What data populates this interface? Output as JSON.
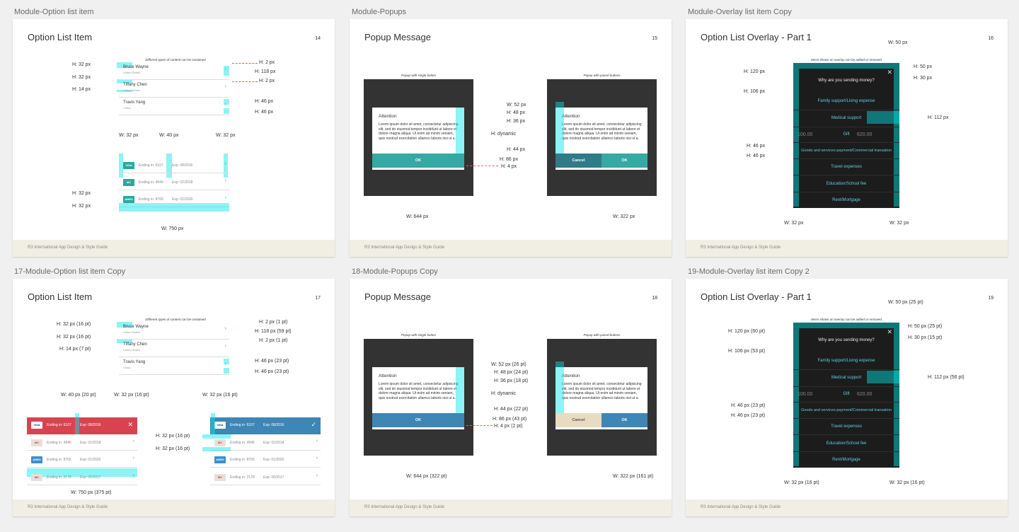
{
  "frames": [
    {
      "label": "Module-Option list item",
      "title": "Option List Item",
      "page": "14",
      "caption": "Different types of content can be contained",
      "people": [
        {
          "name": "Bruce Wayne",
          "sub": "United States"
        },
        {
          "name": "Tiffany Chen",
          "sub": "United States"
        },
        {
          "name": "Travis Yang",
          "sub": "China"
        }
      ],
      "cards": [
        {
          "brand": "VISA",
          "ending": "Ending in: 6107",
          "exp": "Exp: 08/2016"
        },
        {
          "brand": "MC",
          "ending": "Ending in: 4946",
          "exp": "Exp: 02/2018"
        },
        {
          "brand": "AMEX",
          "ending": "Ending in: 8765",
          "exp": "Exp: 01/2020"
        }
      ],
      "dims_left": [
        "H: 32 px",
        "H: 32 px",
        "H: 14 px",
        "H: 32 px",
        "H: 32 px"
      ],
      "dims_right": [
        "H: 2 px",
        "H: 118 px",
        "H: 2 px",
        "H: 46 px",
        "H: 46 px"
      ],
      "dims_widths": [
        "W: 32 px",
        "W: 40 px",
        "W: 32 px"
      ],
      "dim_bottom": "W: 750 px",
      "footer": "R3 International App Design & Style Guide"
    },
    {
      "label": "Module-Popups",
      "title": "Popup Message",
      "page": "15",
      "caption_single": "Popup with single button",
      "caption_paired": "Popup with paired buttons",
      "dialog_title": "Attention",
      "dialog_body": "Lorem ipsum dolor sit amet, consectetur adipiscing elit, sed do eiusmod tempor incididunt ut labore et dolore magna aliqua. Ut enim ad minim veniam, quis nostrud exercitation ullamco laboris nisi ut a.",
      "ok": "OK",
      "cancel": "Cancel",
      "dims_mid": [
        "W: 52 px",
        "H: 48 px",
        "H: 36 px",
        "H: dynamic",
        "H: 44 px",
        "H: 86 px",
        "H: 4 px"
      ],
      "dim_left": "W: 644 px",
      "dim_right": "W: 322 px",
      "footer": "R3 International App Design & Style Guide"
    },
    {
      "label": "Module-Overlay list item Copy",
      "title": "Option List Overlay - Part 1",
      "page": "16",
      "caption": "Items shown on overlay can be added or removed",
      "question": "Why are you sending money?",
      "items": [
        "Family support/Living expense",
        "Medical support",
        "Gift",
        "Goods and services payment/Commercial transation",
        "Travel expenses",
        "Education/School fee",
        "Rent/Mortgage"
      ],
      "bg_amount": "100.00",
      "bg_amount2": "620.00",
      "dims_top": "W: 50 px",
      "dims_left": [
        "H: 120 px",
        "H: 106 px",
        "H: 46 px",
        "H: 46 px"
      ],
      "dims_right": [
        "H: 50 px",
        "H: 30 px",
        "H: 112 px"
      ],
      "dims_bottom": [
        "W: 32 px",
        "W: 32 px"
      ],
      "footer": "R3 International App Design & Style Guide"
    },
    {
      "label": "17-Module-Option list item Copy",
      "title": "Option List Item",
      "page": "17",
      "caption": "Different types of content can be contained",
      "people": [
        {
          "name": "Bruce Wayne",
          "sub": "United States"
        },
        {
          "name": "Tiffany Chen",
          "sub": "United States"
        },
        {
          "name": "Travis Yang",
          "sub": "China"
        }
      ],
      "cards": [
        {
          "brand": "VISA",
          "ending": "Ending in: 6107",
          "exp": "Exp: 08/2016"
        },
        {
          "brand": "MC",
          "ending": "Ending in: 4946",
          "exp": "Exp: 02/2018"
        },
        {
          "brand": "AMEX",
          "ending": "Ending in: 8765",
          "exp": "Exp: 01/2020"
        },
        {
          "brand": "MC",
          "ending": "Ending in: 2178",
          "exp": "Exp: 06/2017"
        }
      ],
      "dims_left": [
        "H: 32 px (16 pt)",
        "H: 32 px (16 pt)",
        "H: 14 px (7 pt)"
      ],
      "dims_right": [
        "H: 2 px (1 pt)",
        "H: 118 px (59 pt)",
        "H: 2 px (1 pt)",
        "H: 46 px (23 pt)",
        "H: 46 px (23 pt)"
      ],
      "dims_widths": [
        "W: 40 px (20 pt)",
        "W: 32 px (16 pt)",
        "W: 32 px (16 pt)"
      ],
      "dims_mid": [
        "H: 32 px (16 pt)",
        "H: 32 px (16 pt)"
      ],
      "dim_bottom": "W: 750 px (375 pt)",
      "footer": "R3 International App Design & Style Guide"
    },
    {
      "label": "18-Module-Popups Copy",
      "title": "Popup Message",
      "page": "18",
      "caption_single": "Popup with single button",
      "caption_paired": "Popup with paired buttons",
      "dialog_title": "Attention",
      "dialog_body": "Lorem ipsum dolor sit amet, consectetur adipiscing elit, sed do eiusmod tempor incididunt ut labore et dolore magna aliqua. Ut enim ad minim veniam, quis nostrud exercitation ullamco laboris nisi ut a.",
      "ok": "OK",
      "cancel": "Cancel",
      "dims_mid": [
        "W: 52 px (26 pt)",
        "H: 48 px (24 pt)",
        "H: 36 px (18 pt)",
        "H: dynamic",
        "H: 44 px (22 pt)",
        "H: 86 px (43 pt)",
        "H: 4 px (2 pt)"
      ],
      "dim_left": "W: 644 px (322 pt)",
      "dim_right": "W: 322 px (161 pt)",
      "footer": "R3 International App Design & Style Guide"
    },
    {
      "label": "19-Module-Overlay list item Copy 2",
      "title": "Option List Overlay - Part 1",
      "page": "19",
      "caption": "Items shown on overlay can be added or removed",
      "question": "Why are you sending money?",
      "items": [
        "Family support/Living expense",
        "Medical support",
        "Gift",
        "Goods and services payment/Commercial transation",
        "Travel expenses",
        "Education/School fee",
        "Rent/Mortgage"
      ],
      "bg_amount": "100.00",
      "bg_amount2": "620.00",
      "dims_top": "W: 50 px (25 pt)",
      "dims_left": [
        "H: 120 px (60 pt)",
        "H: 106 px (53 pt)",
        "H: 46 px (23 pt)",
        "H: 46 px (23 pt)"
      ],
      "dims_right": [
        "H: 50 px (25 pt)",
        "H: 30 px (15 pt)",
        "H: 112 px (56 pt)"
      ],
      "dims_bottom": [
        "W: 32 px (16 pt)",
        "W: 32 px (16 pt)"
      ],
      "footer": "R3 International App Design & Style Guide"
    }
  ],
  "colors": {
    "teal": "#35a9a4",
    "red": "#d9434f",
    "blue": "#3d86b6",
    "highlight": "#00e6e6",
    "footer_bg": "#f1eee3"
  }
}
